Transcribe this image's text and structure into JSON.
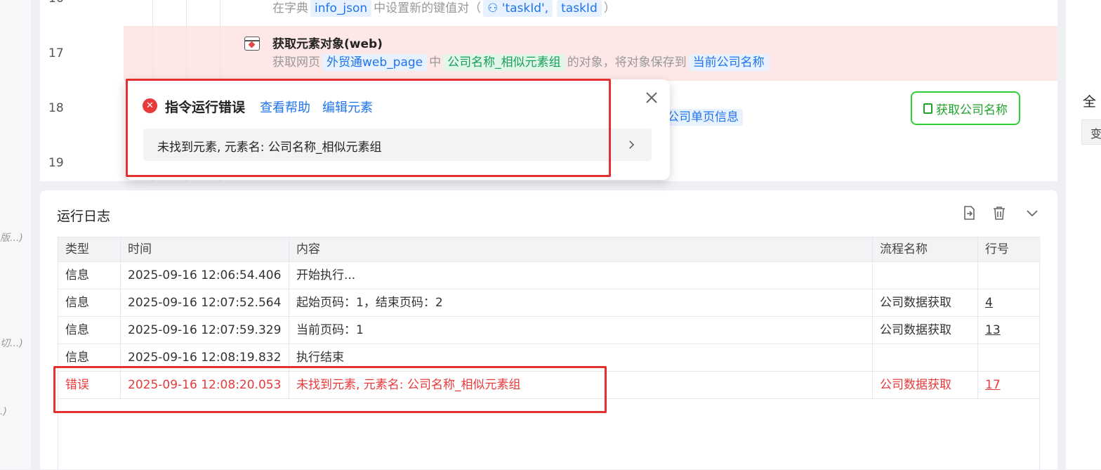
{
  "left_strip": {
    "fragments": [
      "版...)",
      "切...)",
      ".)"
    ]
  },
  "editor": {
    "line_numbers": [
      "16",
      "17",
      "18",
      "19"
    ],
    "row16": {
      "prefix": "在字典",
      "var": "info_json",
      "mid": "中设置新的键值对（",
      "key": "'taskId',",
      "val": "taskId",
      "suffix": "）"
    },
    "row17": {
      "title": "获取元素对象(web)",
      "d1": "获取网页",
      "page_var": "外贸通web_page",
      "d2": "中",
      "element": "公司名称_相似元素组",
      "d3": "的对象，将对象保存到",
      "save_var": "当前公司名称"
    },
    "row18": {
      "chip": "公司单页信息",
      "button_label": "获取公司名称"
    }
  },
  "right_panel": {
    "title_frag": "全",
    "sub_frag": "变"
  },
  "popup": {
    "title": "指令运行错误",
    "help_link": "查看帮助",
    "edit_link": "编辑元素",
    "message": "未找到元素, 元素名: 公司名称_相似元素组"
  },
  "log": {
    "title": "运行日志",
    "columns": [
      "类型",
      "时间",
      "内容",
      "流程名称",
      "行号"
    ],
    "rows": [
      {
        "type": "信息",
        "time": "2025-09-16 12:06:54.406",
        "content": "开始执行...",
        "flow": "",
        "line": ""
      },
      {
        "type": "信息",
        "time": "2025-09-16 12:07:52.564",
        "content": "起始页码：1，结束页码：2",
        "flow": "公司数据获取",
        "line": "4"
      },
      {
        "type": "信息",
        "time": "2025-09-16 12:07:59.329",
        "content": "当前页码：1",
        "flow": "公司数据获取",
        "line": "13"
      },
      {
        "type": "信息",
        "time": "2025-09-16 12:08:19.832",
        "content": "执行结束",
        "flow": "",
        "line": ""
      },
      {
        "type": "错误",
        "time": "2025-09-16 12:08:20.053",
        "content": "未找到元素, 元素名: 公司名称_相似元素组",
        "flow": "公司数据获取",
        "line": "17"
      }
    ]
  },
  "colors": {
    "error": "#e8393b",
    "link": "#1f74ec",
    "highlight_row": "#fde7e7",
    "annotation": "#e3312f",
    "button_green": "#2fcf37"
  }
}
